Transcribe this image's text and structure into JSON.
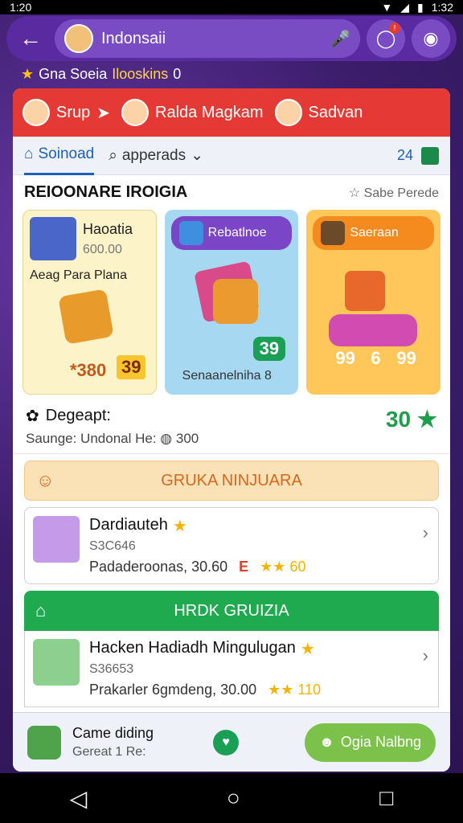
{
  "status": {
    "time": "1:20",
    "right": "1:32"
  },
  "appbar": {
    "title": "Indonsaii",
    "badge": "!"
  },
  "subline": {
    "prefix": "Gna Soeia",
    "highlight": "Ilooskins",
    "count": "0"
  },
  "redbar": {
    "item1": "Srup",
    "item2": "Ralda Magkam",
    "item3": "Sadvan"
  },
  "tabs": {
    "tab1": "Soinoad",
    "tab2": "apperads",
    "right_num": "24"
  },
  "section": {
    "title": "REIOONARE IROIGIA",
    "link": "Sabe Perede"
  },
  "cards": [
    {
      "title": "Haoatia",
      "price": "600.00",
      "subtitle": "Aeag Para Plana",
      "bottom_left": "*380",
      "bottom_right": "39"
    },
    {
      "pill": "Rebatlnoe",
      "bottom": "Senaanelniha 8",
      "num": "39"
    },
    {
      "pill": "Saeraan",
      "nums": [
        "99",
        "6",
        "99"
      ]
    }
  ],
  "info": {
    "title": "Degeapt:",
    "subtitle": "Saunge: Undonal He:",
    "amount": "300",
    "value": "30"
  },
  "banner1": {
    "text": "GRUKA NINJUARA"
  },
  "item1": {
    "name": "Dardiauteh",
    "code": "S3C646",
    "meta": "Padaderoonas, 30.60",
    "tag": "E",
    "stars": "★★ 60"
  },
  "banner2": {
    "text": "HRDK GRUIZIA"
  },
  "item2": {
    "name": "Hacken Hadiadh Mingulugan",
    "code": "S36653",
    "meta": "Prakarler 6gmdeng, 30.00",
    "stars": "★★ 110"
  },
  "footer": {
    "title": "Came diding",
    "subtitle": "Gereat 1 Re:",
    "button": "Ogia Nalbng"
  }
}
